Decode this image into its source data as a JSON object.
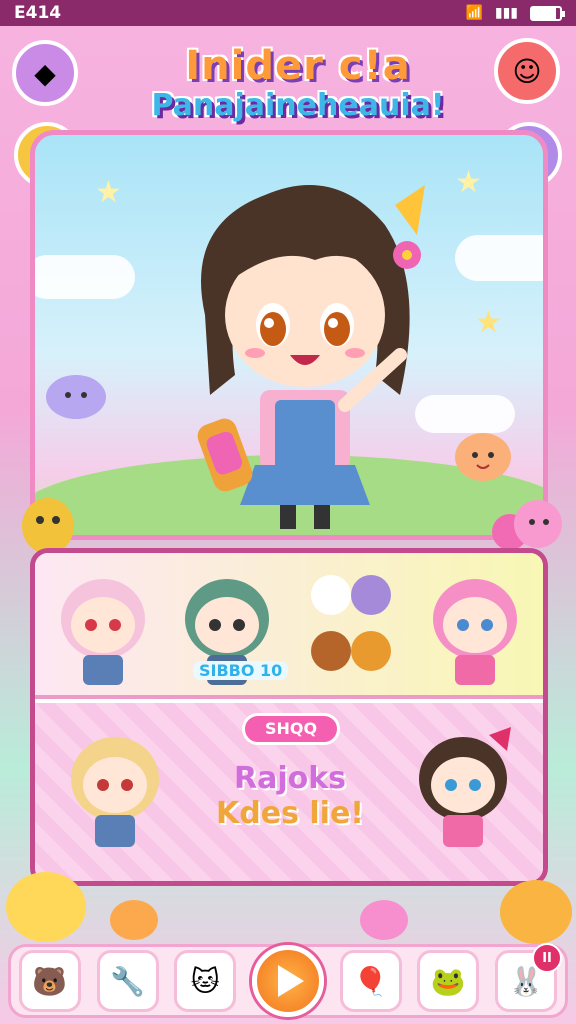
{
  "status_bar": {
    "time": "E414",
    "battery_level": 0.85
  },
  "title": {
    "line1": "Inider c!a",
    "line2": "Panajaineheauia!"
  },
  "roster": {
    "code_label": "SIBBO 10",
    "badge_label": "SHQQ",
    "promo_line1": "Rajoks",
    "promo_line2": "Kdes lie!"
  },
  "colors": {
    "accent_pink": "#f45fb1",
    "accent_orange": "#f2751e",
    "frame": "#c44a8e"
  },
  "nav": {
    "items": [
      "bear-icon",
      "wrench-icon",
      "cat-icon",
      "play-icon",
      "balloon-icon",
      "frog-icon",
      "bunny-icon"
    ],
    "pause_label": "II"
  }
}
